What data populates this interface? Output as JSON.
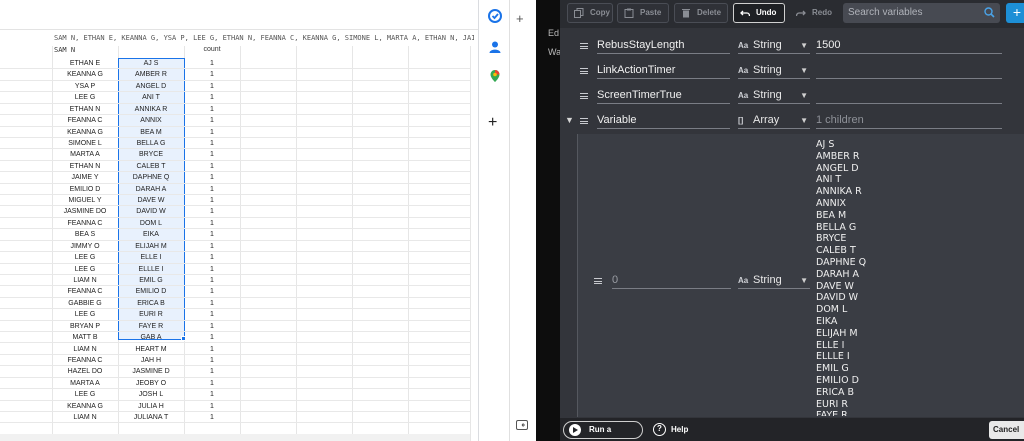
{
  "sheet": {
    "formula_text": "SAM N, ETHAN E, KEANNA G, YSA P, LEE G, ETHAN N, FEANNA C, KEANNA G, SIMONE L, MARTA A, ETHAN N, JAIME",
    "header_a": "SAM N",
    "header_c": "count",
    "rows": [
      {
        "a": "ETHAN E",
        "b": "AJ S",
        "c": "1"
      },
      {
        "a": "KEANNA G",
        "b": "AMBER R",
        "c": "1"
      },
      {
        "a": "YSA P",
        "b": "ANGEL D",
        "c": "1"
      },
      {
        "a": "LEE G",
        "b": "ANI T",
        "c": "1"
      },
      {
        "a": "ETHAN N",
        "b": "ANNIKA R",
        "c": "1"
      },
      {
        "a": "FEANNA C",
        "b": "ANNIX",
        "c": "1"
      },
      {
        "a": "KEANNA G",
        "b": "BEA M",
        "c": "1"
      },
      {
        "a": "SIMONE L",
        "b": "BELLA G",
        "c": "1"
      },
      {
        "a": "MARTA A",
        "b": "BRYCE",
        "c": "1"
      },
      {
        "a": "ETHAN N",
        "b": "CALEB T",
        "c": "1"
      },
      {
        "a": "JAIME Y",
        "b": "DAPHNE Q",
        "c": "1"
      },
      {
        "a": "EMILIO D",
        "b": "DARAH A",
        "c": "1"
      },
      {
        "a": "MIGUEL Y",
        "b": "DAVE W",
        "c": "1"
      },
      {
        "a": "JASMINE DO",
        "b": "DAVID W",
        "c": "1"
      },
      {
        "a": "FEANNA C",
        "b": "DOM L",
        "c": "1"
      },
      {
        "a": "BEA S",
        "b": "EIKA",
        "c": "1"
      },
      {
        "a": "JIMMY O",
        "b": "ELIJAH M",
        "c": "1"
      },
      {
        "a": "LEE G",
        "b": "ELLE I",
        "c": "1"
      },
      {
        "a": "LEE G",
        "b": "ELLLE I",
        "c": "1"
      },
      {
        "a": "LIAM N",
        "b": "EMIL G",
        "c": "1"
      },
      {
        "a": "FEANNA C",
        "b": "EMILIO D",
        "c": "1"
      },
      {
        "a": "GABBIE G",
        "b": "ERICA B",
        "c": "1"
      },
      {
        "a": "LEE G",
        "b": "EURI R",
        "c": "1"
      },
      {
        "a": "BRYAN P",
        "b": "FAYE R",
        "c": "1"
      },
      {
        "a": "MATT B",
        "b": "GAB A",
        "c": "1"
      },
      {
        "a": "LIAM N",
        "b": "HEART M",
        "c": "1"
      },
      {
        "a": "FEANNA C",
        "b": "JAH H",
        "c": "1"
      },
      {
        "a": "HAZEL DO",
        "b": "JASMINE D",
        "c": "1"
      },
      {
        "a": "MARTA A",
        "b": "JEOBY O",
        "c": "1"
      },
      {
        "a": "LEE G",
        "b": "JOSH L",
        "c": "1"
      },
      {
        "a": "KEANNA G",
        "b": "JULIA H",
        "c": "1"
      },
      {
        "a": "LIAM N",
        "b": "JULIANA T",
        "c": "1"
      }
    ]
  },
  "side_panel": {
    "icons": [
      "tasks-icon",
      "contacts-icon",
      "maps-icon",
      "add-icon"
    ],
    "plus_label": "+"
  },
  "dark_strip": {
    "text1": "Ed",
    "text2": "Wa"
  },
  "toolbar": {
    "copy": "Copy",
    "paste": "Paste",
    "delete": "Delete",
    "undo": "Undo",
    "redo": "Redo",
    "search_placeholder": "Search variables",
    "add": "+"
  },
  "variables": [
    {
      "name": "RebusStayLength",
      "type_icon": "Aa",
      "type": "String",
      "value": "1500"
    },
    {
      "name": "LinkActionTimer",
      "type_icon": "Aa",
      "type": "String",
      "value": ""
    },
    {
      "name": "ScreenTimerTrue",
      "type_icon": "Aa",
      "type": "String",
      "value": ""
    },
    {
      "name": "Variable",
      "type_icon": "[]",
      "type": "Array",
      "value": "1 children"
    }
  ],
  "child": {
    "index": "0",
    "type_icon": "Aa",
    "type": "String",
    "items": [
      "AJ S",
      "AMBER R",
      "ANGEL D",
      "ANI T",
      "ANNIKA R",
      "ANNIX",
      "BEA M",
      "BELLA G",
      "BRYCE",
      "CALEB T",
      "DAPHNE Q",
      "DARAH A",
      "DAVE W",
      "DAVID W",
      "DOM L",
      "EIKA",
      "ELIJAH M",
      "ELLE I",
      "ELLLE I",
      "EMIL G",
      "EMILIO D",
      "ERICA B",
      "EURI R",
      "FAYE R"
    ]
  },
  "bottom": {
    "run_preview": "Run a preview",
    "help": "Help",
    "cancel": "Cancel"
  }
}
